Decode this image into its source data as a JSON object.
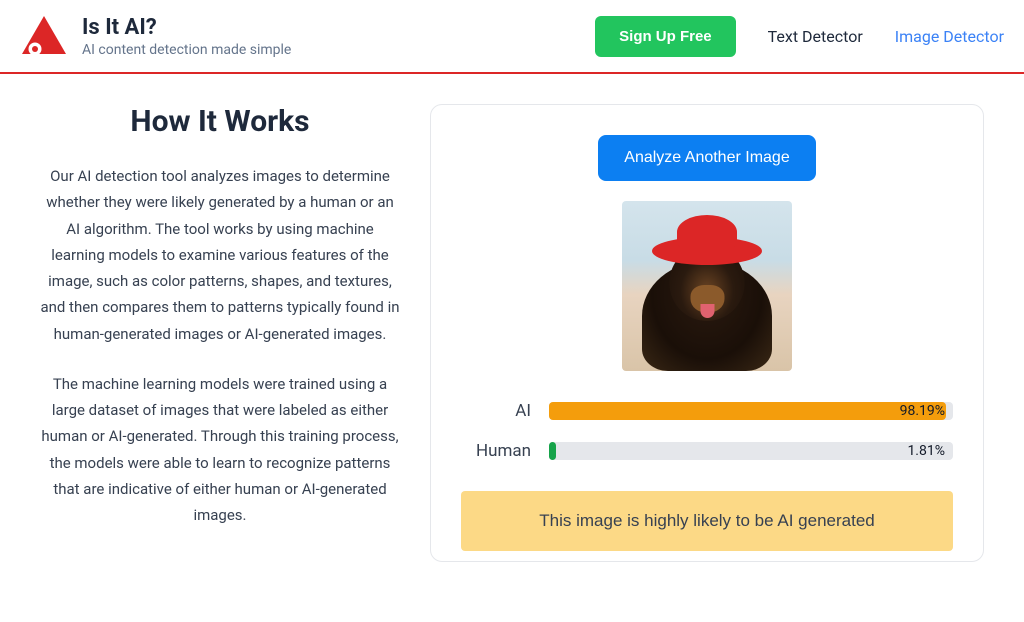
{
  "header": {
    "title": "Is It AI?",
    "subtitle": "AI content detection made simple",
    "signup_label": "Sign Up Free",
    "nav": {
      "text_detector": "Text Detector",
      "image_detector": "Image Detector"
    }
  },
  "left": {
    "heading": "How It Works",
    "para1": "Our AI detection tool analyzes images to determine whether they were likely generated by a human or an AI algorithm. The tool works by using machine learning models to examine various features of the image, such as color patterns, shapes, and textures, and then compares them to patterns typically found in human-generated images or AI-generated images.",
    "para2": "The machine learning models were trained using a large dataset of images that were labeled as either human or AI-generated. Through this training process, the models were able to learn to recognize patterns that are indicative of either human or AI-generated images."
  },
  "panel": {
    "analyze_label": "Analyze Another Image",
    "ai_label": "AI",
    "human_label": "Human",
    "ai_percent": "98.19%",
    "human_percent": "1.81%",
    "verdict": "This image is highly likely to be AI generated"
  },
  "chart_data": {
    "type": "bar",
    "categories": [
      "AI",
      "Human"
    ],
    "values": [
      98.19,
      1.81
    ],
    "xlabel": "",
    "ylabel": "Percent",
    "ylim": [
      0,
      100
    ]
  },
  "colors": {
    "accent_red": "#dc2626",
    "button_green": "#22c55e",
    "button_blue": "#0c7ff2",
    "bar_ai": "#f49d0c",
    "bar_human": "#16a34a",
    "banner_bg": "#fcd986",
    "link_active": "#3b82f6"
  }
}
